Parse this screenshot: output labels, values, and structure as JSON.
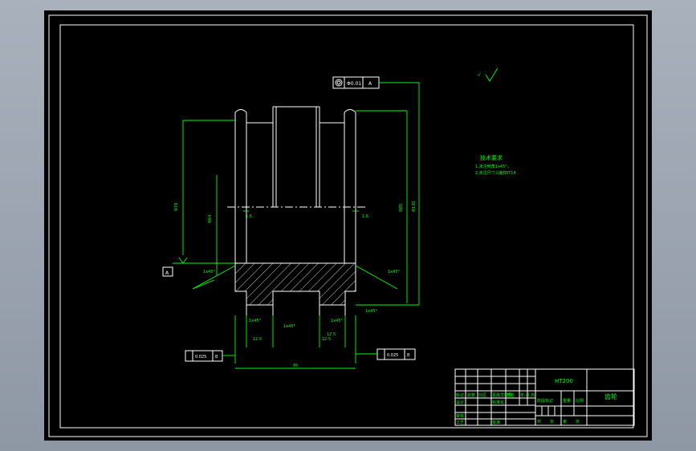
{
  "drawing": {
    "position_tolerance": {
      "symbol": "◎",
      "value": "Φ0.01",
      "datum": "A"
    },
    "surface_finish_mark": "√",
    "tech_requirements": {
      "title": "技术要求",
      "line1": "1.未注倒角1x45°。",
      "line2": "2.未注尺寸公差按IT14"
    },
    "datum_label": "A",
    "hatch_section": "section",
    "dims": {
      "height_left": "Φ78",
      "height_inner": "Φ64",
      "height_right": "Φ85",
      "outer_right": "Φ130",
      "bottom_width": "95",
      "chamfer_top_left": "1x45°",
      "chamfer_top_right": "1x45°",
      "chamfer_mid_left": "1x45°",
      "chamfer_mid": "1x45°",
      "chamfer_mid_right": "1x45°",
      "chamfer_right": "1x45°",
      "slot_left": "12.5",
      "slot_mid": "12.5",
      "slot_mid2": "12.5",
      "small_left": "1.6",
      "small_right": "1.6"
    },
    "left_tolerance_box": {
      "value": "0.025",
      "datum": "B"
    },
    "right_tolerance_box": {
      "value": "0.025",
      "datum": "B"
    }
  },
  "title_block": {
    "material": "HT200",
    "part_name": "齿轮",
    "row_labels": [
      "标记",
      "处数",
      "分区",
      "更改文件号",
      "签名",
      "年.月.日"
    ],
    "designer": "设计",
    "standardization": "标准化",
    "review": "审核",
    "craft": "工艺",
    "approve": "批准",
    "stage": "阶段标记",
    "weight": "重量",
    "scale": "比例",
    "sheet_total": "共",
    "sheet": "张",
    "sheet_no": "第",
    "sheet_no2": "张"
  }
}
